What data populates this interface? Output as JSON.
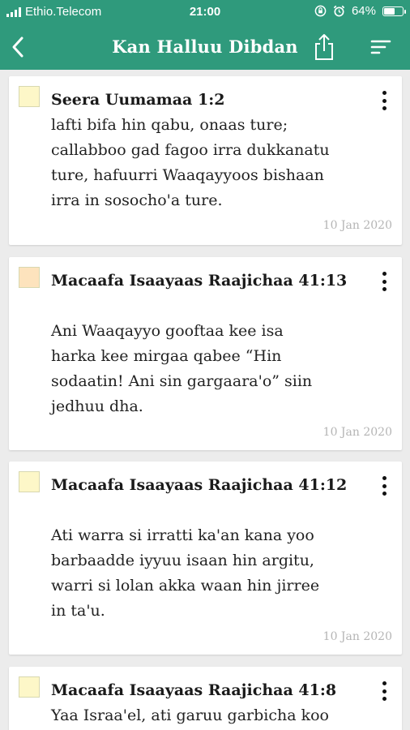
{
  "status": {
    "carrier": "Ethio.Telecom",
    "time": "21:00",
    "battery": "64%",
    "battery_level": 0.64
  },
  "nav": {
    "title": "Kan Halluu Dibdan",
    "back_icon": "chevron-left-icon",
    "share_icon": "share-icon",
    "sort_icon": "sort-icon"
  },
  "notes": [
    {
      "color": "#fdf7c8",
      "title": "Seera Uumamaa 1:2",
      "lines": [
        "lafti bifa hin qabu, onaas ture;",
        "callabboo gad fagoo irra dukkanatu",
        "ture, hafuurri Waaqayyoos bishaan",
        "irra in sosocho'a ture."
      ],
      "date": "10 Jan 2020"
    },
    {
      "color": "#fde3bd",
      "title": "Macaafa Isaayaas Raajichaa 41:13",
      "lines": [
        "Ani Waaqayyo gooftaa kee isa",
        "harka kee mirgaa qabee “Hin",
        "sodaatin! Ani sin gargaara'o” siin",
        "jedhuu dha."
      ],
      "date": "10 Jan 2020"
    },
    {
      "color": "#fdf7c8",
      "title": "Macaafa Isaayaas Raajichaa 41:12",
      "lines": [
        "Ati warra si irratti ka'an kana yoo",
        "barbaadde iyyuu isaan hin argitu,",
        "warri si lolan akka waan hin jirree",
        "in ta'u."
      ],
      "date": "10 Jan 2020"
    },
    {
      "color": "#fdf7c8",
      "title": "Macaafa Isaayaas Raajichaa 41:8",
      "lines": [
        "Yaa Israa'el, ati garuu garbicha koo"
      ],
      "date": ""
    }
  ]
}
